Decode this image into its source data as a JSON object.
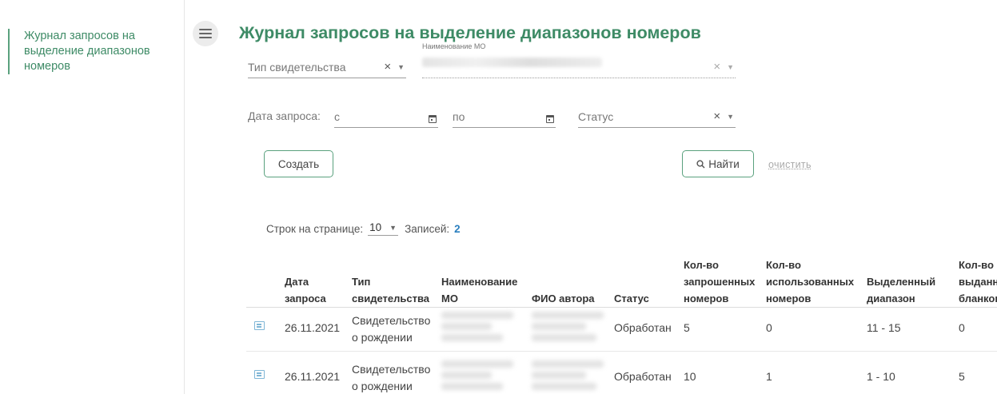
{
  "sidebar": {
    "items": [
      {
        "label": "Журнал запросов на выделение диапазонов номеров"
      }
    ]
  },
  "header": {
    "title": "Журнал запросов на выделение диапазонов номеров",
    "menu_icon": "hamburger-icon"
  },
  "filters": {
    "certificate_type": {
      "placeholder": "Тип свидетельства",
      "value": ""
    },
    "organization": {
      "label": "Наименование МО",
      "value": ""
    },
    "request_date": {
      "label": "Дата запроса:",
      "from_placeholder": "с",
      "to_placeholder": "по"
    },
    "status": {
      "placeholder": "Статус",
      "value": ""
    },
    "clear_symbol": "×",
    "caret_symbol": "▼"
  },
  "actions": {
    "create_label": "Создать",
    "search_label": "Найти",
    "clear_label": "очистить"
  },
  "pagination": {
    "rows_label": "Строк на странице:",
    "rows_value": "10",
    "records_label": "Записей:",
    "records_count": "2"
  },
  "table": {
    "columns": [
      "Дата запроса",
      "Тип свидетельства",
      "Наименование МО",
      "ФИО автора",
      "Статус",
      "Кол-во запрошенных номеров",
      "Кол-во использованных номеров",
      "Выделенный диапазон",
      "Кол-во выданных бланков"
    ],
    "rows": [
      {
        "date": "26.11.2021",
        "type": "Свидетельство о рождении",
        "status": "Обработан",
        "requested": "5",
        "used": "0",
        "range": "11 - 15",
        "issued": "0"
      },
      {
        "date": "26.11.2021",
        "type": "Свидетельство о рождении",
        "status": "Обработан",
        "requested": "10",
        "used": "1",
        "range": "1 - 10",
        "issued": "5"
      }
    ]
  },
  "colors": {
    "accent": "#3e8b66",
    "border_accent": "#5aa17e",
    "link_blue": "#2a7fbf"
  }
}
